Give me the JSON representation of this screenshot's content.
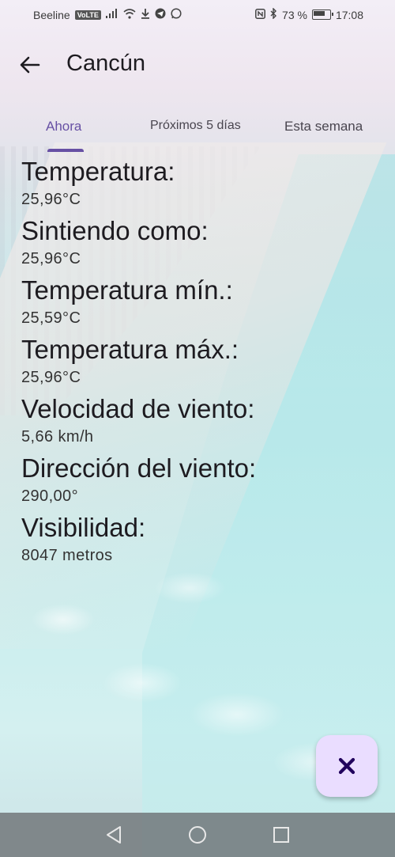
{
  "status_bar": {
    "carrier": "Beeline",
    "volte": "VoLTE",
    "battery_percent": "73 %",
    "time": "17:08"
  },
  "app_bar": {
    "title": "Cancún"
  },
  "tabs": [
    {
      "label": "Ahora",
      "active": true
    },
    {
      "label": "Próximos 5 días",
      "active": false
    },
    {
      "label": "Esta semana",
      "active": false
    }
  ],
  "weather": [
    {
      "label": "Temperatura:",
      "value": "25,96°C"
    },
    {
      "label": "Sintiendo como:",
      "value": "25,96°C"
    },
    {
      "label": "Temperatura mín.:",
      "value": "25,59°C"
    },
    {
      "label": "Temperatura máx.:",
      "value": "25,96°C"
    },
    {
      "label": "Velocidad de viento:",
      "value": "5,66 km/h"
    },
    {
      "label": "Dirección del viento:",
      "value": "290,00°"
    },
    {
      "label": "Visibilidad:",
      "value": "8047 metros"
    }
  ],
  "fab": {
    "icon": "close-icon",
    "color": "#eaddff",
    "icon_color": "#21005d"
  },
  "colors": {
    "accent": "#6750a4"
  }
}
